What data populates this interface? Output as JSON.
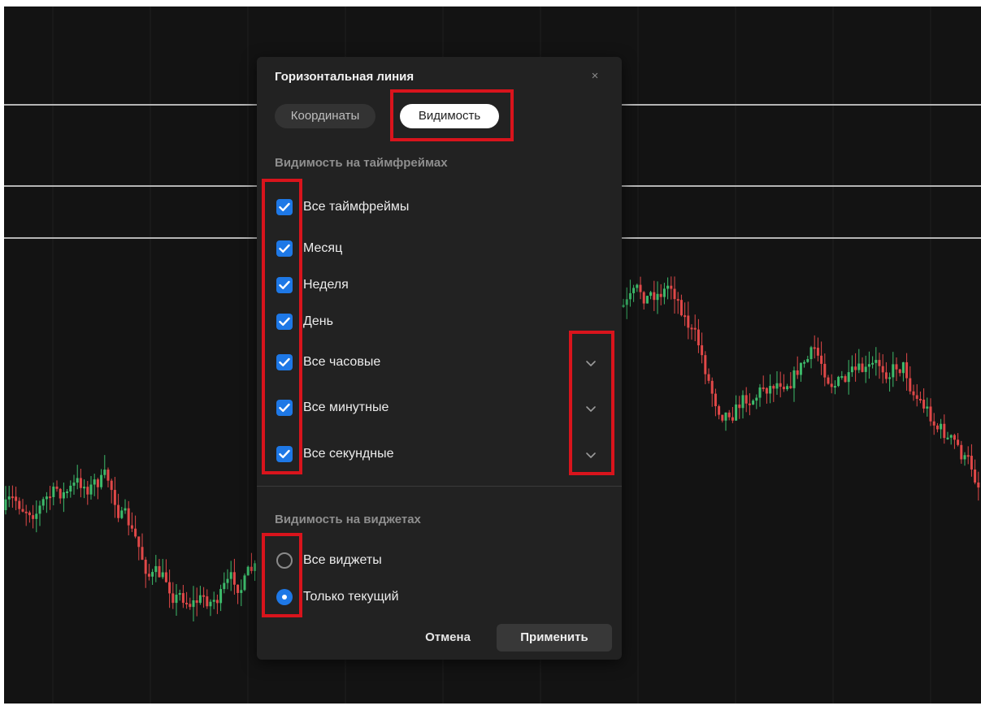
{
  "dialog": {
    "title": "Горизонтальная линия",
    "close_glyph": "×",
    "tabs": {
      "coordinates": "Координаты",
      "visibility": "Видимость",
      "active": "visibility"
    },
    "timeframes": {
      "section_title": "Видимость на таймфреймах",
      "items": [
        {
          "label": "Все таймфреймы",
          "checked": true,
          "expandable": false
        },
        {
          "label": "Месяц",
          "checked": true,
          "expandable": false
        },
        {
          "label": "Неделя",
          "checked": true,
          "expandable": false
        },
        {
          "label": "День",
          "checked": true,
          "expandable": false
        },
        {
          "label": "Все часовые",
          "checked": true,
          "expandable": true
        },
        {
          "label": "Все минутные",
          "checked": true,
          "expandable": true
        },
        {
          "label": "Все секундные",
          "checked": true,
          "expandable": true
        }
      ]
    },
    "widgets": {
      "section_title": "Видимость на виджетах",
      "options": [
        {
          "label": "Все виджеты",
          "selected": false
        },
        {
          "label": "Только текущий",
          "selected": true
        }
      ]
    },
    "buttons": {
      "cancel": "Отмена",
      "apply": "Применить"
    }
  },
  "colors": {
    "accent": "#1e78e6",
    "highlight": "#d9141c",
    "candle_up": "#3dbb6b",
    "candle_down": "#e04848",
    "chart_bg": "#131313"
  },
  "icons": {
    "close": "close-icon",
    "checkbox": "check-icon",
    "expand": "chevron-down-icon"
  }
}
